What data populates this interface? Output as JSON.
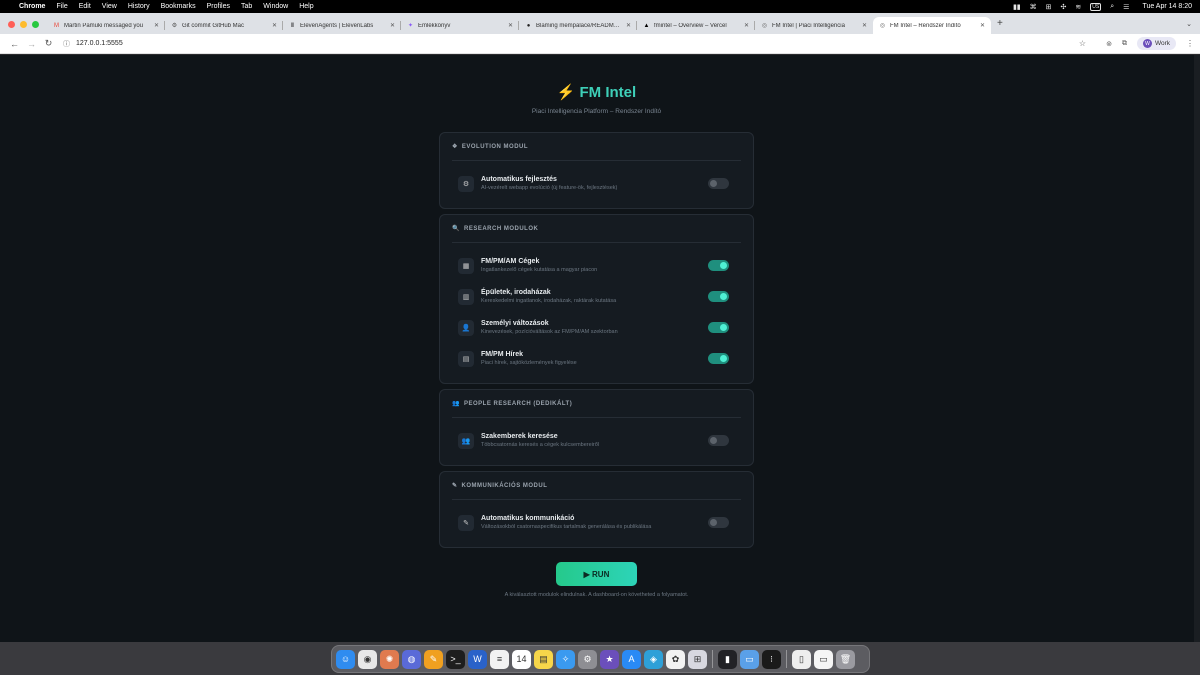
{
  "menubar": {
    "items": [
      "Chrome",
      "File",
      "Edit",
      "View",
      "History",
      "Bookmarks",
      "Profiles",
      "Tab",
      "Window",
      "Help"
    ],
    "status_icons": [
      "▮▮",
      "⌘",
      "⊞",
      "✣",
      "≋",
      "US",
      "⌕",
      "☰"
    ],
    "datetime": "Tue Apr 14  8:20"
  },
  "tabs": [
    {
      "title": "Martin Pamuki messaged you",
      "icon": "M",
      "color": "#ea4335"
    },
    {
      "title": "Git commit GitHub Mac",
      "icon": "⚙",
      "color": "#555555"
    },
    {
      "title": "ElevenAgents | ElevenLabs",
      "icon": "Ⅱ",
      "color": "#000000"
    },
    {
      "title": "Emlékkönyv",
      "icon": "✦",
      "color": "#8a5cf6"
    },
    {
      "title": "Blaming mempalace/README.md",
      "icon": "●",
      "color": "#222222"
    },
    {
      "title": "fmintel – Overview – Vercel",
      "icon": "▲",
      "color": "#000000"
    },
    {
      "title": "FM Intel | Piaci Intelligencia",
      "icon": "◎",
      "color": "#666666"
    },
    {
      "title": "FM Intel – Rendszer Indító",
      "icon": "◎",
      "color": "#666666",
      "active": true
    }
  ],
  "address": {
    "url": "127.0.0.1:5555",
    "profile_label": "Work",
    "profile_initial": "W"
  },
  "page": {
    "brand_icon": "⚡",
    "brand_title": "FM Intel",
    "subtitle": "Piaci Intelligencia Platform – Rendszer Indító",
    "sections": [
      {
        "header": "EVOLUTION MODUL",
        "header_icon": "❖",
        "rows": [
          {
            "label": "Automatikus fejlesztés",
            "desc": "AI-vezérelt webapp evolúció (új feature-ök, fejlesztések)",
            "icon": "⚙",
            "on": false
          }
        ]
      },
      {
        "header": "RESEARCH MODULOK",
        "header_icon": "🔍",
        "rows": [
          {
            "label": "FM/PM/AM Cégek",
            "desc": "Ingatlankezelő cégek kutatása a magyar piacon",
            "icon": "▦",
            "on": true
          },
          {
            "label": "Épületek, irodaházak",
            "desc": "Kereskedelmi ingatlanok, irodaházak, raktárak kutatása",
            "icon": "▥",
            "on": true
          },
          {
            "label": "Személyi változások",
            "desc": "Kinevezések, pozícióváltások az FM/PM/AM szektorban",
            "icon": "👤",
            "on": true
          },
          {
            "label": "FM/PM Hírek",
            "desc": "Piaci hírek, sajtóközlemények figyelése",
            "icon": "▤",
            "on": true
          }
        ]
      },
      {
        "header": "PEOPLE RESEARCH (DEDIKÁLT)",
        "header_icon": "👥",
        "rows": [
          {
            "label": "Szakemberek keresése",
            "desc": "Többcsatornás keresés a cégek kulcsembereiről",
            "icon": "👥",
            "on": false
          }
        ]
      },
      {
        "header": "KOMMUNIKÁCIÓS MODUL",
        "header_icon": "✎",
        "rows": [
          {
            "label": "Automatikus kommunikáció",
            "desc": "Változásokból csatornaspecifikus tartalmak generálása és publikálása",
            "icon": "✎",
            "on": false
          }
        ]
      }
    ],
    "run_label": "▶  RUN",
    "hint": "A kiválasztott modulok elindulnak. A dashboard-on követheted a folyamatot."
  },
  "dock": {
    "apps": [
      {
        "name": "finder",
        "glyph": "☺",
        "color": "#2f8cf0"
      },
      {
        "name": "chrome",
        "glyph": "◉",
        "color": "#e8e8e8"
      },
      {
        "name": "claude",
        "glyph": "✺",
        "color": "#e07a4f"
      },
      {
        "name": "app-blue",
        "glyph": "◍",
        "color": "#5a6ad8"
      },
      {
        "name": "pencil",
        "glyph": "✎",
        "color": "#f0a020"
      },
      {
        "name": "terminal",
        "glyph": ">_",
        "color": "#1e1e1e"
      },
      {
        "name": "word",
        "glyph": "W",
        "color": "#2a62c9"
      },
      {
        "name": "notes-list",
        "glyph": "≡",
        "color": "#f2f2f2"
      },
      {
        "name": "calendar",
        "glyph": "14",
        "color": "#ffffff"
      },
      {
        "name": "notes",
        "glyph": "▤",
        "color": "#f7d64a"
      },
      {
        "name": "safari",
        "glyph": "✧",
        "color": "#3a9af0"
      },
      {
        "name": "settings",
        "glyph": "⚙",
        "color": "#8e8e93"
      },
      {
        "name": "imovie",
        "glyph": "★",
        "color": "#6b4fbb"
      },
      {
        "name": "appstore",
        "glyph": "A",
        "color": "#2a8af5"
      },
      {
        "name": "app-green",
        "glyph": "◈",
        "color": "#2ea0d8"
      },
      {
        "name": "photos",
        "glyph": "✿",
        "color": "#f2f2f2"
      },
      {
        "name": "launchpad",
        "glyph": "⊞",
        "color": "#d8d8e0"
      }
    ],
    "apps2": [
      {
        "name": "app-bars",
        "glyph": "▮",
        "color": "#222226"
      },
      {
        "name": "app-window",
        "glyph": "▭",
        "color": "#5aa0e8"
      },
      {
        "name": "app-grid",
        "glyph": "⁝",
        "color": "#1a1a1a"
      }
    ],
    "apps3": [
      {
        "name": "doc",
        "glyph": "▯",
        "color": "#eeeeee"
      },
      {
        "name": "preview",
        "glyph": "▭",
        "color": "#f5f5f5"
      },
      {
        "name": "trash",
        "glyph": "🗑",
        "color": "#9a9aa0"
      }
    ]
  }
}
